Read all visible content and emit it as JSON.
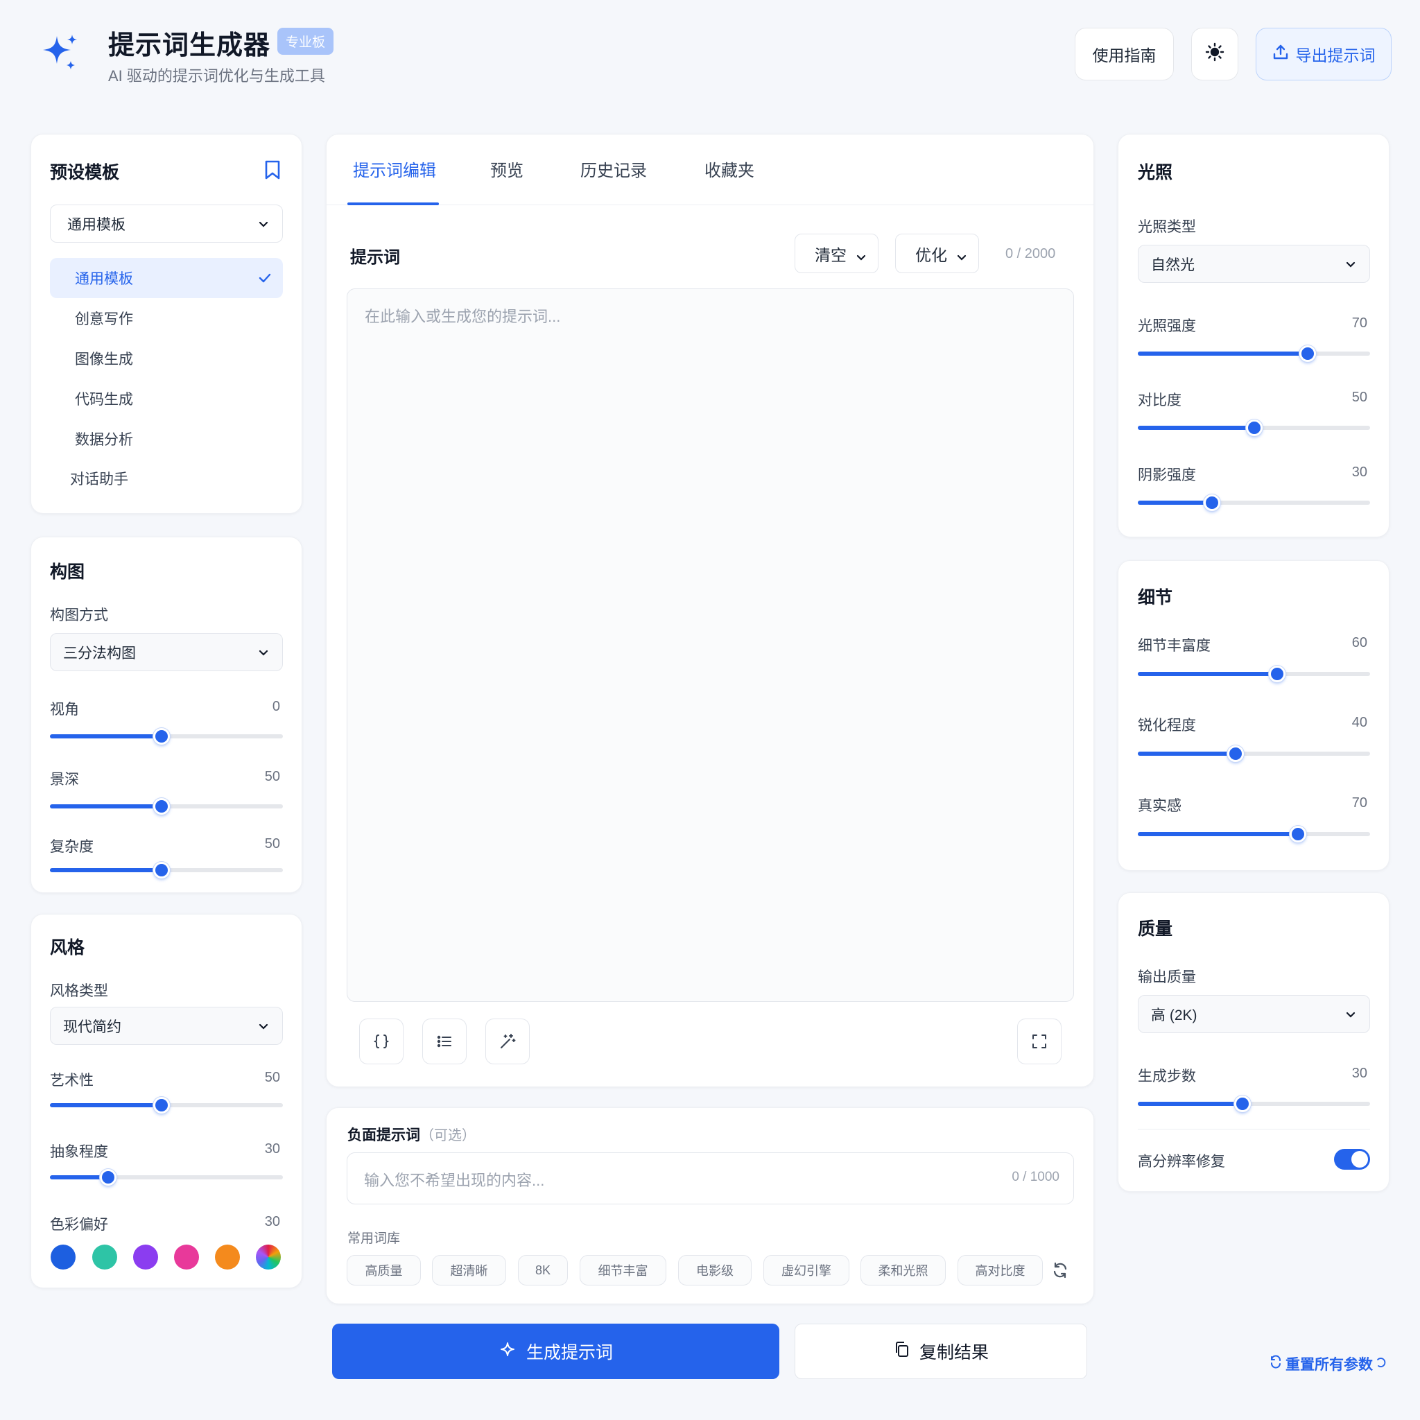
{
  "app": {
    "title": "提示词生成器",
    "badge": "专业板",
    "subtitle": "AI 驱动的提示词优化与生成工具",
    "brand_color": "#2563eb"
  },
  "header": {
    "guide_label": "使用指南",
    "theme_icon": "sun-icon",
    "export_label": "导出提示词"
  },
  "templates": {
    "title": "预设模板",
    "selected": "通用模板",
    "items": [
      {
        "label": "通用模板",
        "active": true
      },
      {
        "label": "创意写作",
        "active": false
      },
      {
        "label": "图像生成",
        "active": false
      },
      {
        "label": "代码生成",
        "active": false
      },
      {
        "label": "数据分析",
        "active": false
      },
      {
        "label": "对话助手",
        "active": false
      }
    ]
  },
  "composition": {
    "title": "构图",
    "method_label": "构图方式",
    "method_value": "三分法构图",
    "sliders": [
      {
        "label": "视角",
        "value": "0",
        "percent": 48
      },
      {
        "label": "景深",
        "value": "50",
        "percent": 48
      },
      {
        "label": "复杂度",
        "value": "50",
        "percent": 48
      }
    ]
  },
  "style": {
    "title": "风格",
    "type_label": "风格类型",
    "type_value": "现代简约",
    "sliders": [
      {
        "label": "艺术性",
        "value": "50",
        "percent": 48
      },
      {
        "label": "抽象程度",
        "value": "30",
        "percent": 25
      }
    ],
    "color_label": "色彩偏好",
    "color_value": "30",
    "swatches": [
      "#1d5fe0",
      "#2ec4a6",
      "#8b3df0",
      "#e8399a",
      "#f48a1d",
      "rainbow"
    ]
  },
  "editor": {
    "tabs": [
      "提示词编辑",
      "预览",
      "历史记录",
      "收藏夹"
    ],
    "active_tab": 0,
    "section_title": "提示词",
    "clear_label": "清空",
    "optimize_label": "优化",
    "char_count": "0 / 2000",
    "placeholder": "在此输入或生成您的提示词...",
    "tools": [
      "braces-icon",
      "list-icon",
      "magic-wand-icon"
    ],
    "fullscreen_icon": "expand-icon"
  },
  "negative": {
    "title": "负面提示词",
    "optional": "（可选）",
    "placeholder": "输入您不希望出现的内容...",
    "char_count": "0 / 1000",
    "library_label": "常用词库",
    "chips": [
      "高质量",
      "超清晰",
      "8K",
      "细节丰富",
      "电影级",
      "虚幻引擎",
      "柔和光照",
      "高对比度"
    ]
  },
  "actions": {
    "generate_label": "生成提示词",
    "copy_label": "复制结果",
    "reset_label": "重置所有参数"
  },
  "lighting": {
    "title": "光照",
    "type_label": "光照类型",
    "type_value": "自然光",
    "sliders": [
      {
        "label": "光照强度",
        "value": "70",
        "percent": 73
      },
      {
        "label": "对比度",
        "value": "50",
        "percent": 50
      },
      {
        "label": "阴影强度",
        "value": "30",
        "percent": 32
      }
    ]
  },
  "detail": {
    "title": "细节",
    "sliders": [
      {
        "label": "细节丰富度",
        "value": "60",
        "percent": 60
      },
      {
        "label": "锐化程度",
        "value": "40",
        "percent": 42
      },
      {
        "label": "真实感",
        "value": "70",
        "percent": 69
      }
    ]
  },
  "quality": {
    "title": "质量",
    "output_label": "输出质量",
    "output_value": "高 (2K)",
    "steps_label": "生成步数",
    "steps_value": "30",
    "steps_percent": 45,
    "hires_label": "高分辨率修复",
    "hires_on": true
  }
}
